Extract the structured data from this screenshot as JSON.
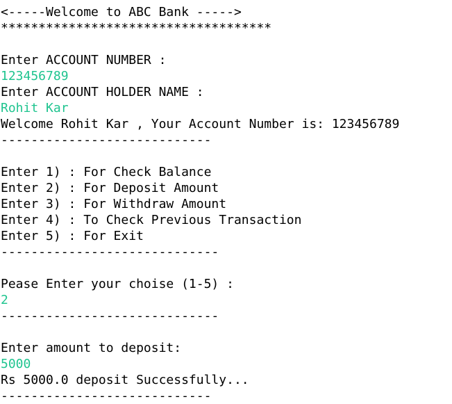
{
  "colors": {
    "output_text": "#000000",
    "user_input_text": "#1fc48f",
    "background": "#ffffff"
  },
  "console": {
    "clipped_top_line": "    ))) ((  )) ( ( ( ( ) (( ( ( (",
    "welcome_banner": "<-----Welcome to ABC Bank ----->",
    "banner_stars": "************************************",
    "prompt_account_number": "Enter ACCOUNT NUMBER :",
    "input_account_number": "123456789",
    "prompt_holder_name": "Enter ACCOUNT HOLDER NAME :",
    "input_holder_name": "Rohit Kar",
    "welcome_message": "Welcome Rohit Kar , Your Account Number is: 123456789",
    "separator_1": "----------------------------",
    "menu": [
      "Enter 1) : For Check Balance",
      "Enter 2) : For Deposit Amount",
      "Enter 3) : For Withdraw Amount",
      "Enter 4) : To Check Previous Transaction",
      "Enter 5) : For Exit"
    ],
    "separator_2": "-----------------------------",
    "prompt_choice": "Pease Enter your choise (1-5) :",
    "input_choice": "2",
    "separator_3": "-----------------------------",
    "prompt_deposit": "Enter amount to deposit:",
    "input_deposit": "5000",
    "deposit_result": "Rs 5000.0 deposit Successfully...",
    "separator_4": "----------------------------"
  }
}
